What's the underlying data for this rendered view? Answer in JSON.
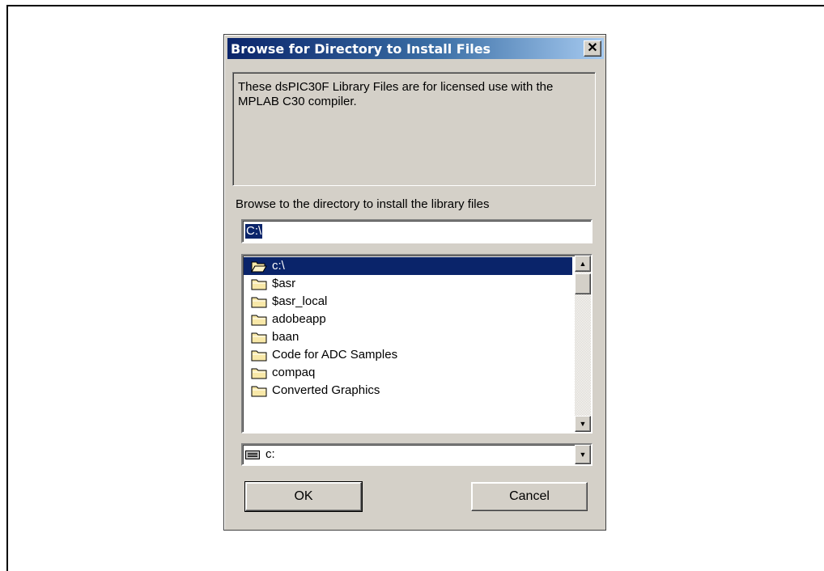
{
  "dialog": {
    "title": "Browse for Directory to Install Files",
    "close_glyph": "✕",
    "info_text": "These dsPIC30F Library Files are for licensed use with the MPLAB C30 compiler.",
    "browse_label": "Browse to the directory to install the library files",
    "path_value": "C:\\",
    "folders": [
      {
        "name": "c:\\",
        "icon": "open-folder-icon",
        "selected": true
      },
      {
        "name": "$asr",
        "icon": "folder-icon"
      },
      {
        "name": "$asr_local",
        "icon": "folder-icon"
      },
      {
        "name": "adobeapp",
        "icon": "folder-icon"
      },
      {
        "name": "baan",
        "icon": "folder-icon"
      },
      {
        "name": "Code for ADC Samples",
        "icon": "folder-icon"
      },
      {
        "name": "compaq",
        "icon": "folder-icon"
      },
      {
        "name": "Converted Graphics",
        "icon": "folder-icon"
      }
    ],
    "drive_value": "c:",
    "ok_label": "OK",
    "cancel_label": "Cancel"
  },
  "colors": {
    "face": "#d4d0c8",
    "title_start": "#0a246a",
    "title_end": "#a6caf0",
    "selection": "#0a246a",
    "folder": "#f8e8a8"
  }
}
